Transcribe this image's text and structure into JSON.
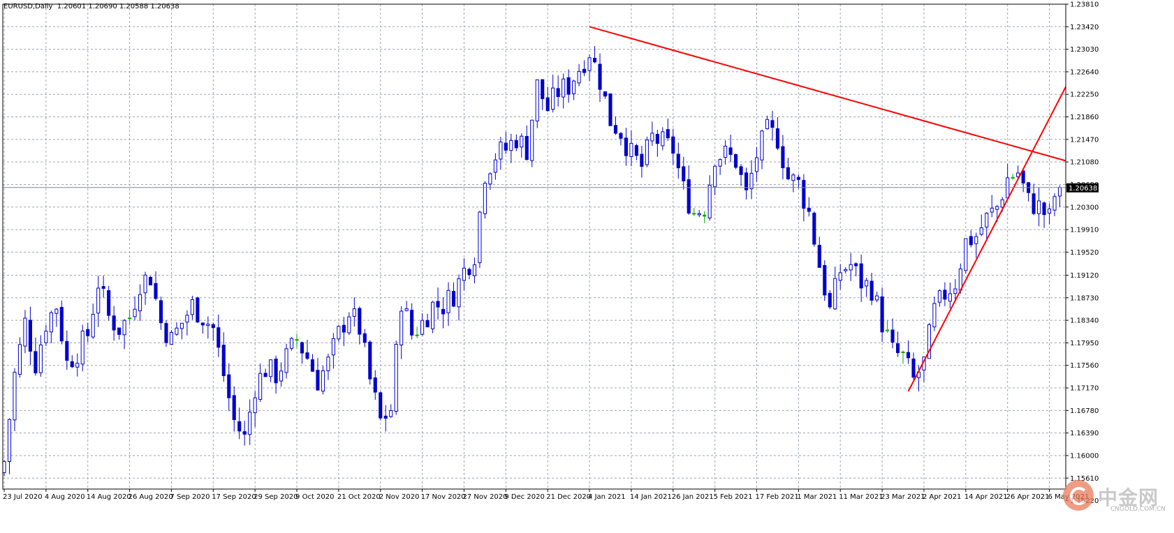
{
  "header": {
    "symbol": "EURUSD,Daily",
    "ohlc": "1.20601 1.20690 1.20588 1.20638"
  },
  "watermark": {
    "brand_cn": "中金网",
    "url": "CNGOLD.COM.CN"
  },
  "colors": {
    "candle": "#0000cc",
    "doji": "#00aa00",
    "trendline": "#ff0000",
    "grid": "#9aa3b0",
    "axis": "#000000",
    "bid_line": "#7c8796",
    "price_label_bg": "#000000",
    "price_label_text": "#ffffff"
  },
  "chart_data": {
    "type": "candlestick",
    "symbol": "EURUSD",
    "timeframe": "Daily",
    "ylim": [
      1.1542,
      1.2381
    ],
    "grid": true,
    "y_ticks": [
      "1.23810",
      "1.23420",
      "1.23030",
      "1.22640",
      "1.22250",
      "1.21860",
      "1.21470",
      "1.21080",
      "1.20690",
      "1.20300",
      "1.19910",
      "1.19520",
      "1.19120",
      "1.18730",
      "1.18340",
      "1.17950",
      "1.17560",
      "1.17170",
      "1.16780",
      "1.16390",
      "1.16000",
      "1.15610",
      "1.15220"
    ],
    "x_ticks": [
      {
        "label": "23 Jul 2020",
        "index": 0
      },
      {
        "label": "4 Aug 2020",
        "index": 8
      },
      {
        "label": "14 Aug 2020",
        "index": 16
      },
      {
        "label": "26 Aug 2020",
        "index": 24
      },
      {
        "label": "7 Sep 2020",
        "index": 32
      },
      {
        "label": "17 Sep 2020",
        "index": 40
      },
      {
        "label": "29 Sep 2020",
        "index": 48
      },
      {
        "label": "9 Oct 2020",
        "index": 56
      },
      {
        "label": "21 Oct 2020",
        "index": 64
      },
      {
        "label": "2 Nov 2020",
        "index": 72
      },
      {
        "label": "17 Nov 2020",
        "index": 80
      },
      {
        "label": "27 Nov 2020",
        "index": 88
      },
      {
        "label": "9 Dec 2020",
        "index": 96
      },
      {
        "label": "21 Dec 2020",
        "index": 104
      },
      {
        "label": "4 Jan 2021",
        "index": 112
      },
      {
        "label": "14 Jan 2021",
        "index": 120
      },
      {
        "label": "26 Jan 2021",
        "index": 128
      },
      {
        "label": "5 Feb 2021",
        "index": 136
      },
      {
        "label": "17 Feb 2021",
        "index": 144
      },
      {
        "label": "1 Mar 2021",
        "index": 152
      },
      {
        "label": "11 Mar 2021",
        "index": 160
      },
      {
        "label": "23 Mar 2021",
        "index": 168
      },
      {
        "label": "2 Apr 2021",
        "index": 176
      },
      {
        "label": "14 Apr 2021",
        "index": 184
      },
      {
        "label": "26 Apr 2021",
        "index": 192
      },
      {
        "label": "6 May 2021",
        "index": 200
      }
    ],
    "current_price": "1.20638",
    "anchors": [
      [
        0,
        1.159
      ],
      [
        2,
        1.174
      ],
      [
        4,
        1.183
      ],
      [
        6,
        1.176
      ],
      [
        8,
        1.183
      ],
      [
        10,
        1.186
      ],
      [
        12,
        1.176
      ],
      [
        14,
        1.178
      ],
      [
        16,
        1.181
      ],
      [
        18,
        1.19
      ],
      [
        20,
        1.184
      ],
      [
        22,
        1.182
      ],
      [
        24,
        1.184
      ],
      [
        26,
        1.19
      ],
      [
        28,
        1.191
      ],
      [
        30,
        1.183
      ],
      [
        32,
        1.18
      ],
      [
        34,
        1.183
      ],
      [
        36,
        1.186
      ],
      [
        38,
        1.184
      ],
      [
        40,
        1.182
      ],
      [
        42,
        1.174
      ],
      [
        44,
        1.166
      ],
      [
        46,
        1.163
      ],
      [
        48,
        1.172
      ],
      [
        50,
        1.175
      ],
      [
        52,
        1.174
      ],
      [
        54,
        1.177
      ],
      [
        56,
        1.18
      ],
      [
        58,
        1.177
      ],
      [
        60,
        1.173
      ],
      [
        62,
        1.176
      ],
      [
        64,
        1.181
      ],
      [
        66,
        1.185
      ],
      [
        68,
        1.182
      ],
      [
        70,
        1.173
      ],
      [
        72,
        1.166
      ],
      [
        74,
        1.168
      ],
      [
        76,
        1.187
      ],
      [
        78,
        1.181
      ],
      [
        80,
        1.183
      ],
      [
        82,
        1.186
      ],
      [
        84,
        1.186
      ],
      [
        86,
        1.188
      ],
      [
        88,
        1.192
      ],
      [
        90,
        1.195
      ],
      [
        92,
        1.209
      ],
      [
        94,
        1.212
      ],
      [
        96,
        1.213
      ],
      [
        98,
        1.215
      ],
      [
        100,
        1.213
      ],
      [
        102,
        1.224
      ],
      [
        104,
        1.22
      ],
      [
        106,
        1.223
      ],
      [
        108,
        1.224
      ],
      [
        110,
        1.227
      ],
      [
        112,
        1.23
      ],
      [
        114,
        1.225
      ],
      [
        116,
        1.218
      ],
      [
        118,
        1.216
      ],
      [
        120,
        1.212
      ],
      [
        122,
        1.21
      ],
      [
        124,
        1.215
      ],
      [
        126,
        1.214
      ],
      [
        128,
        1.213
      ],
      [
        130,
        1.206
      ],
      [
        132,
        1.202
      ],
      [
        134,
        1.203
      ],
      [
        136,
        1.212
      ],
      [
        138,
        1.212
      ],
      [
        140,
        1.211
      ],
      [
        142,
        1.205
      ],
      [
        144,
        1.212
      ],
      [
        146,
        1.216
      ],
      [
        148,
        1.215
      ],
      [
        150,
        1.208
      ],
      [
        152,
        1.207
      ],
      [
        154,
        1.202
      ],
      [
        156,
        1.193
      ],
      [
        158,
        1.185
      ],
      [
        160,
        1.192
      ],
      [
        162,
        1.193
      ],
      [
        164,
        1.19
      ],
      [
        166,
        1.189
      ],
      [
        168,
        1.183
      ],
      [
        170,
        1.178
      ],
      [
        172,
        1.177
      ],
      [
        174,
        1.173
      ],
      [
        176,
        1.176
      ],
      [
        178,
        1.185
      ],
      [
        180,
        1.188
      ],
      [
        182,
        1.19
      ],
      [
        184,
        1.197
      ],
      [
        186,
        1.198
      ],
      [
        188,
        1.201
      ],
      [
        190,
        1.203
      ],
      [
        192,
        1.208
      ],
      [
        194,
        1.209
      ],
      [
        196,
        1.204
      ],
      [
        198,
        1.203
      ],
      [
        200,
        1.201
      ],
      [
        201,
        1.205
      ],
      [
        202,
        1.20638
      ]
    ],
    "trendlines": [
      {
        "from": [
          112,
          1.2342
        ],
        "to": [
          206,
          1.211
        ]
      },
      {
        "from": [
          173,
          1.1711
        ],
        "to": [
          206,
          1.2238
        ]
      }
    ]
  }
}
